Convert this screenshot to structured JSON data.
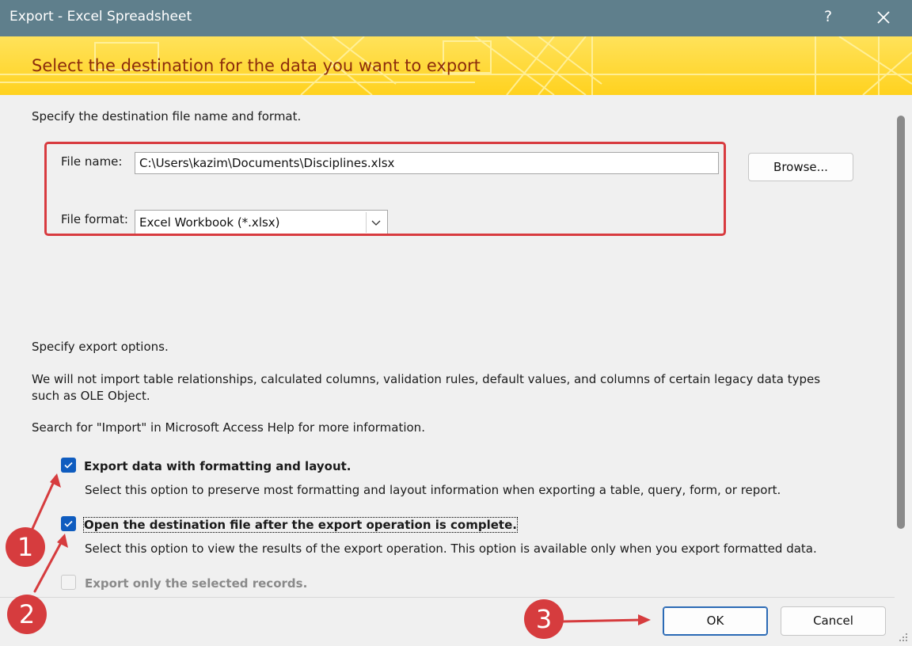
{
  "window": {
    "title": "Export - Excel Spreadsheet",
    "help_glyph": "?"
  },
  "banner": {
    "headline": "Select the destination for the data you want to export"
  },
  "destination": {
    "intro": "Specify the destination file name and format.",
    "file_name_label": "File name:",
    "file_name_value": "C:\\Users\\kazim\\Documents\\Disciplines.xlsx",
    "browse_label": "Browse...",
    "file_format_label": "File format:",
    "file_format_value": "Excel Workbook (*.xlsx)"
  },
  "options": {
    "intro": "Specify export options.",
    "note": "We will not import table relationships, calculated columns, validation rules, default values, and columns of certain legacy data types such as OLE Object.",
    "help": "Search for \"Import\" in Microsoft Access Help for more information.",
    "items": [
      {
        "label": "Export data with formatting and layout.",
        "description": "Select this option to preserve most formatting and layout information when exporting a table, query, form, or report.",
        "checked": true,
        "enabled": true
      },
      {
        "label": "Open the destination file after the export operation is complete.",
        "description": "Select this option to view the results of the export operation. This option is available only when you export formatted data.",
        "checked": true,
        "enabled": true
      },
      {
        "label": "Export only the selected records.",
        "checked": false,
        "enabled": false
      }
    ]
  },
  "buttons": {
    "ok": "OK",
    "cancel": "Cancel"
  },
  "annotations": {
    "badge1": "1",
    "badge2": "2",
    "badge3": "3"
  },
  "colors": {
    "titlebar": "#5f7f8c",
    "banner": "#ffd21f",
    "headline": "#8c2c0c",
    "annotation_red": "#d63c3e",
    "checkbox_blue": "#0f5cbf"
  }
}
